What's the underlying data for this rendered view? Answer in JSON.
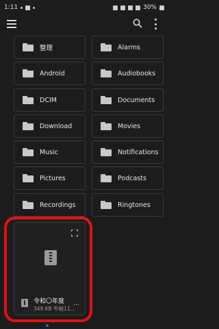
{
  "status_bar": {
    "time": "1:11",
    "battery": "30%"
  },
  "toolbar": {
    "menu_icon": "hamburger-menu-icon",
    "search_icon": "search-icon",
    "more_icon": "more-vert-icon"
  },
  "folders": [
    {
      "label": "整理"
    },
    {
      "label": "Alarms"
    },
    {
      "label": "Android"
    },
    {
      "label": "Audiobooks"
    },
    {
      "label": "DCIM"
    },
    {
      "label": "Documents"
    },
    {
      "label": "Download"
    },
    {
      "label": "Movies"
    },
    {
      "label": "Music"
    },
    {
      "label": "Notifications"
    },
    {
      "label": "Pictures"
    },
    {
      "label": "Podcasts"
    },
    {
      "label": "Recordings"
    },
    {
      "label": "Ringtones"
    }
  ],
  "file_card": {
    "name": "令和〇年度",
    "meta": "349 KB 午前11...",
    "more": "..."
  },
  "colors": {
    "background": "#1c1c1e",
    "border": "#3b3b3e",
    "highlight": "#e41212"
  }
}
